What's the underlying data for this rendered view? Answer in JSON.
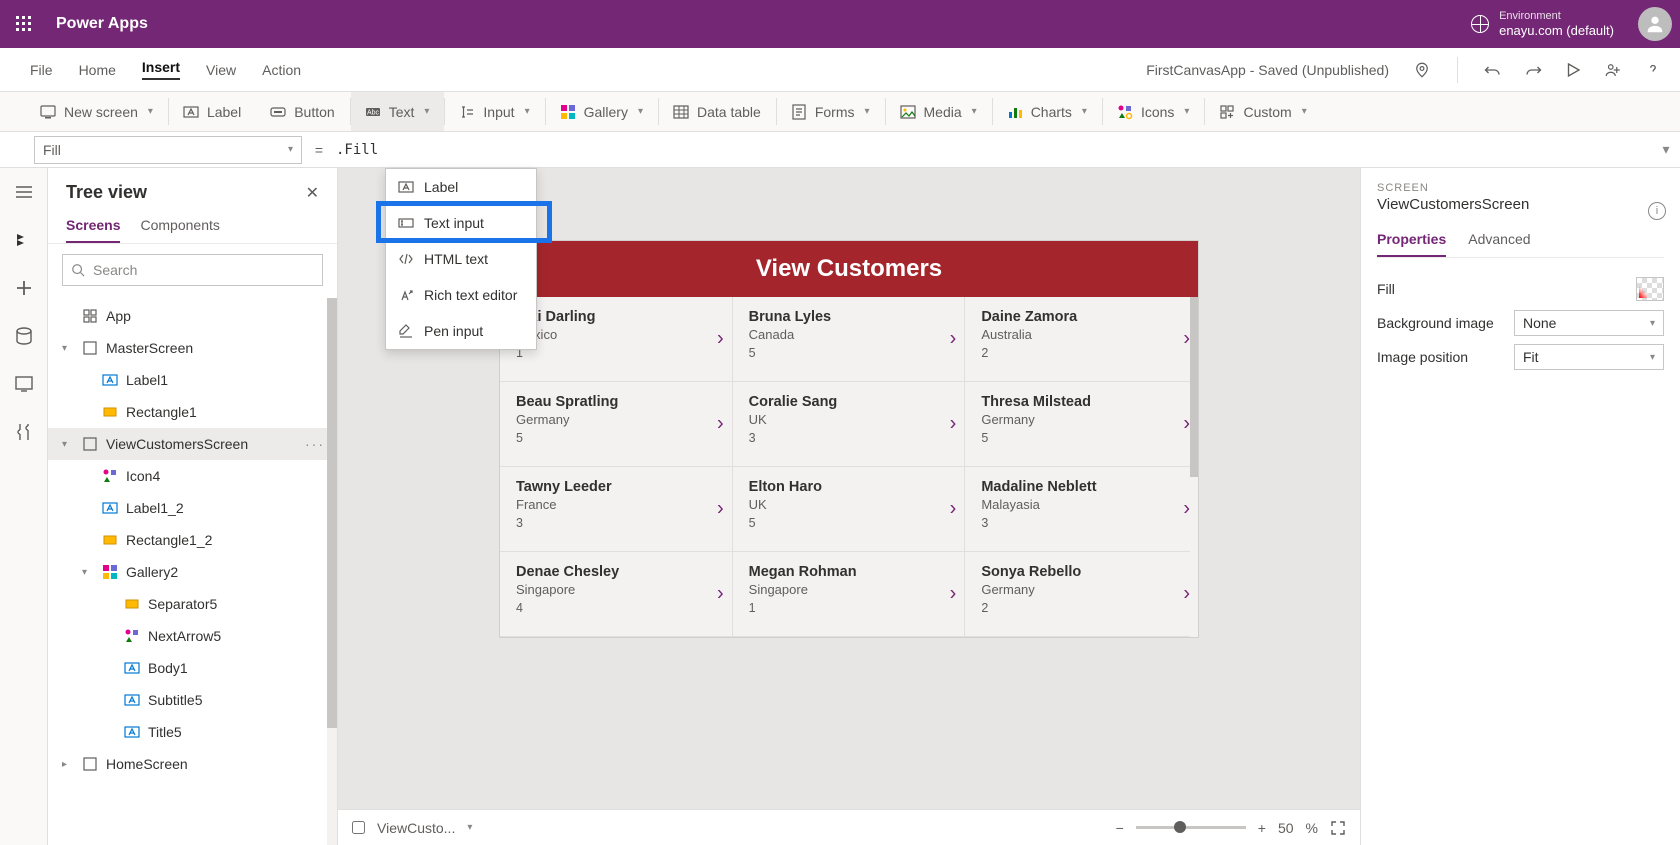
{
  "topbar": {
    "app_name": "Power Apps",
    "env_kicker": "Environment",
    "env_name": "enayu.com (default)"
  },
  "menubar": {
    "items": [
      "File",
      "Home",
      "Insert",
      "View",
      "Action"
    ],
    "active_index": 2,
    "doc_title": "FirstCanvasApp - Saved (Unpublished)"
  },
  "ribbon": {
    "new_screen": "New screen",
    "label": "Label",
    "button": "Button",
    "text": "Text",
    "input": "Input",
    "gallery": "Gallery",
    "data_table": "Data table",
    "forms": "Forms",
    "media": "Media",
    "charts": "Charts",
    "icons": "Icons",
    "custom": "Custom"
  },
  "text_dropdown": {
    "items": [
      "Label",
      "Text input",
      "HTML text",
      "Rich text editor",
      "Pen input"
    ]
  },
  "formula": {
    "property": "Fill",
    "value": ".Fill"
  },
  "tree": {
    "title": "Tree view",
    "tabs": [
      "Screens",
      "Components"
    ],
    "active_tab": 0,
    "search_placeholder": "Search",
    "nodes": [
      {
        "label": "App",
        "level": 0,
        "twisty": "",
        "icon": "app",
        "sel": false
      },
      {
        "label": "MasterScreen",
        "level": 0,
        "twisty": "▾",
        "icon": "screen",
        "sel": false
      },
      {
        "label": "Label1",
        "level": 1,
        "twisty": "",
        "icon": "label",
        "sel": false
      },
      {
        "label": "Rectangle1",
        "level": 1,
        "twisty": "",
        "icon": "rect",
        "sel": false
      },
      {
        "label": "ViewCustomersScreen",
        "level": 0,
        "twisty": "▾",
        "icon": "screen",
        "sel": true,
        "more": true
      },
      {
        "label": "Icon4",
        "level": 1,
        "twisty": "",
        "icon": "icons",
        "sel": false
      },
      {
        "label": "Label1_2",
        "level": 1,
        "twisty": "",
        "icon": "label",
        "sel": false
      },
      {
        "label": "Rectangle1_2",
        "level": 1,
        "twisty": "",
        "icon": "rect",
        "sel": false
      },
      {
        "label": "Gallery2",
        "level": 1,
        "twisty": "▾",
        "icon": "gallery",
        "sel": false
      },
      {
        "label": "Separator5",
        "level": 2,
        "twisty": "",
        "icon": "rect",
        "sel": false
      },
      {
        "label": "NextArrow5",
        "level": 2,
        "twisty": "",
        "icon": "icons",
        "sel": false
      },
      {
        "label": "Body1",
        "level": 2,
        "twisty": "",
        "icon": "label",
        "sel": false
      },
      {
        "label": "Subtitle5",
        "level": 2,
        "twisty": "",
        "icon": "label",
        "sel": false
      },
      {
        "label": "Title5",
        "level": 2,
        "twisty": "",
        "icon": "label",
        "sel": false
      },
      {
        "label": "HomeScreen",
        "level": 0,
        "twisty": "▸",
        "icon": "screen",
        "sel": false
      }
    ]
  },
  "canvas": {
    "header": "View Customers",
    "customers": [
      {
        "name": "Viki  Darling",
        "country": "Mexico",
        "qty": "1"
      },
      {
        "name": "Bruna  Lyles",
        "country": "Canada",
        "qty": "5"
      },
      {
        "name": "Daine  Zamora",
        "country": "Australia",
        "qty": "2"
      },
      {
        "name": "Beau  Spratling",
        "country": "Germany",
        "qty": "5"
      },
      {
        "name": "Coralie  Sang",
        "country": "UK",
        "qty": "3"
      },
      {
        "name": "Thresa  Milstead",
        "country": "Germany",
        "qty": "5"
      },
      {
        "name": "Tawny  Leeder",
        "country": "France",
        "qty": "3"
      },
      {
        "name": "Elton  Haro",
        "country": "UK",
        "qty": "5"
      },
      {
        "name": "Madaline  Neblett",
        "country": "Malayasia",
        "qty": "3"
      },
      {
        "name": "Denae  Chesley",
        "country": "Singapore",
        "qty": "4"
      },
      {
        "name": "Megan  Rohman",
        "country": "Singapore",
        "qty": "1"
      },
      {
        "name": "Sonya  Rebello",
        "country": "Germany",
        "qty": "2"
      }
    ]
  },
  "statusbar": {
    "screen_label": "ViewCusto...",
    "zoom": "50",
    "pct": "%"
  },
  "props": {
    "kicker": "SCREEN",
    "title": "ViewCustomersScreen",
    "tabs": [
      "Properties",
      "Advanced"
    ],
    "active_tab": 0,
    "rows": {
      "fill_label": "Fill",
      "bg_label": "Background image",
      "bg_value": "None",
      "imgpos_label": "Image position",
      "imgpos_value": "Fit"
    }
  }
}
